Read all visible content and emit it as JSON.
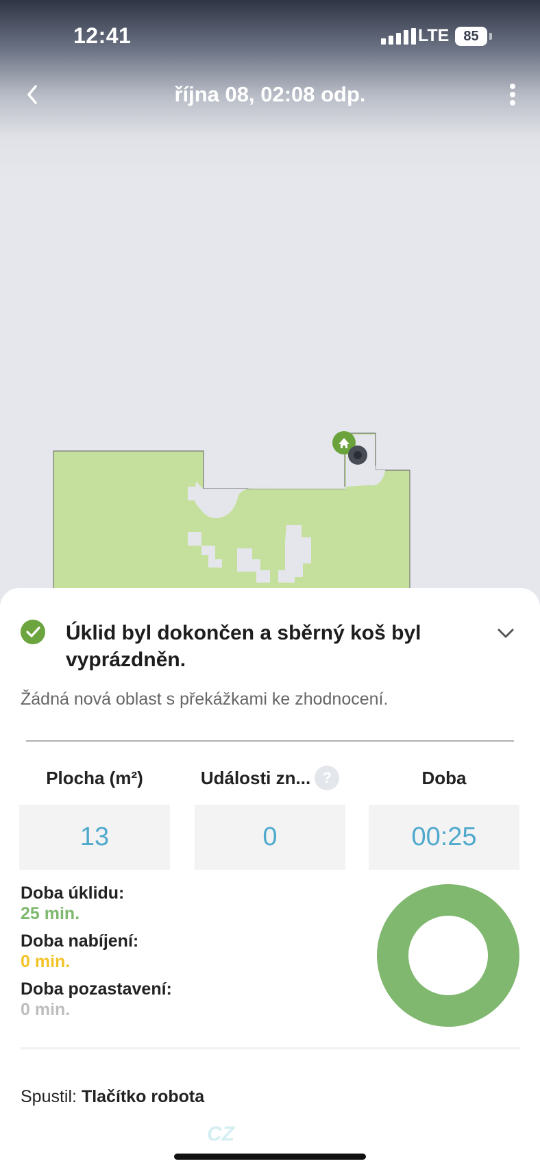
{
  "status_bar": {
    "time": "12:41",
    "network": "LTE",
    "battery": "85"
  },
  "nav": {
    "title": "října 08, 02:08 odp.",
    "back_icon": "chevron-left-icon",
    "more_icon": "more-vertical-icon"
  },
  "map": {
    "cleaned_color": "#c5e09d",
    "dock_icon": "home-icon",
    "robot_icon": "robot-icon"
  },
  "summary": {
    "status_icon": "check-circle-icon",
    "status_title": "Úklid byl dokončen a sběrný koš byl vyprázdněn.",
    "subtitle": "Žádná nová oblast s překážkami ke zhodnocení.",
    "stats": [
      {
        "label": "Plocha (m²)",
        "value": "13"
      },
      {
        "label": "Události zn...",
        "value": "0"
      },
      {
        "label": "Doba",
        "value": "00:25"
      }
    ],
    "help_label": "?",
    "times": [
      {
        "label": "Doba úklidu:",
        "value": "25 min.",
        "color": "#7fb86e"
      },
      {
        "label": "Doba nabíjení:",
        "value": "0 min.",
        "color": "#f3c326"
      },
      {
        "label": "Doba pozastavení:",
        "value": "0 min.",
        "color": "#b8b8b8"
      }
    ],
    "donut": {
      "cleaning_minutes": 25,
      "charging_minutes": 0,
      "paused_minutes": 0,
      "color": "#80b86f"
    },
    "started_by_label": "Spustil:",
    "started_by_value": "Tlačítko robota",
    "watermark": "CZ"
  }
}
